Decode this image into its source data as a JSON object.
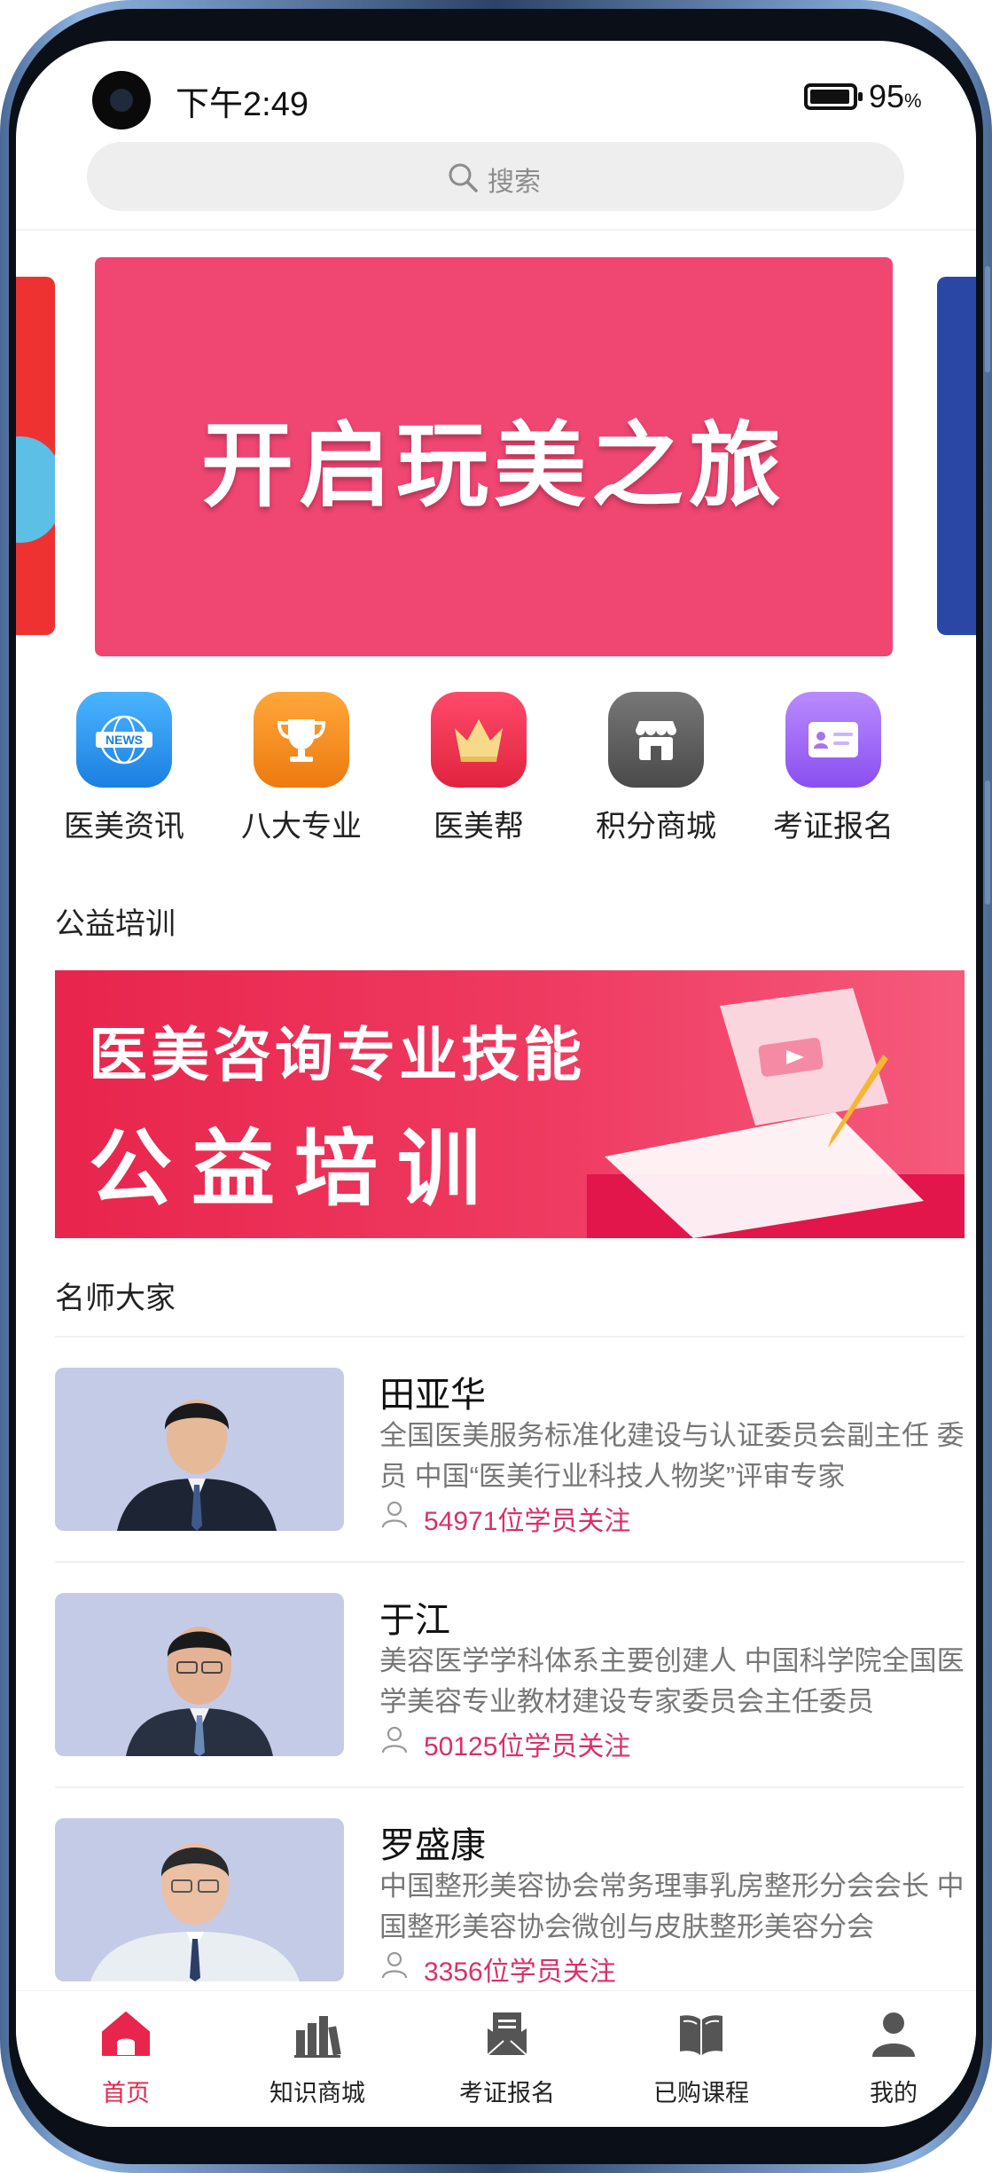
{
  "status_bar": {
    "time": "下午2:49",
    "battery": "95",
    "battery_unit": "%"
  },
  "search": {
    "placeholder": "搜索"
  },
  "banner": {
    "title": "开启玩美之旅"
  },
  "quick_nav": [
    {
      "label": "医美资讯",
      "icon": "news-icon",
      "color": "#2e9af0",
      "badge": "NEWS"
    },
    {
      "label": "八大专业",
      "icon": "trophy-icon",
      "color": "#f08a1c"
    },
    {
      "label": "医美帮",
      "icon": "crown-icon",
      "color": "#ec2f4f"
    },
    {
      "label": "积分商城",
      "icon": "shop-icon",
      "color": "#5a5a5a"
    },
    {
      "label": "考证报名",
      "icon": "id-card-icon",
      "color": "#9c5cf0"
    }
  ],
  "sections": {
    "public_training": "公益培训",
    "famous_teachers": "名师大家"
  },
  "promo": {
    "line1": "医美咨询专业技能",
    "line2": "公益培训"
  },
  "teachers": [
    {
      "name": "田亚华",
      "desc": "全国医美服务标准化建设与认证委员会副主任 委员 中国“医美行业科技人物奖”评审专家",
      "follow": "54971位学员关注"
    },
    {
      "name": "于江",
      "desc": "美容医学学科体系主要创建人 中国科学院全国医学美容专业教材建设专家委员会主任委员",
      "follow": "50125位学员关注"
    },
    {
      "name": "罗盛康",
      "desc": "中国整形美容协会常务理事乳房整形分会会长 中国整形美容协会微创与皮肤整形美容分会",
      "follow": "3356位学员关注"
    }
  ],
  "bottom_nav": [
    {
      "label": "首页",
      "icon": "home-icon",
      "active": true
    },
    {
      "label": "知识商城",
      "icon": "books-icon"
    },
    {
      "label": "考证报名",
      "icon": "exam-icon"
    },
    {
      "label": "已购课程",
      "icon": "open-book-icon"
    },
    {
      "label": "我的",
      "icon": "person-icon"
    }
  ],
  "colors": {
    "accent": "#e8254c",
    "follow_text": "#d9306a"
  }
}
